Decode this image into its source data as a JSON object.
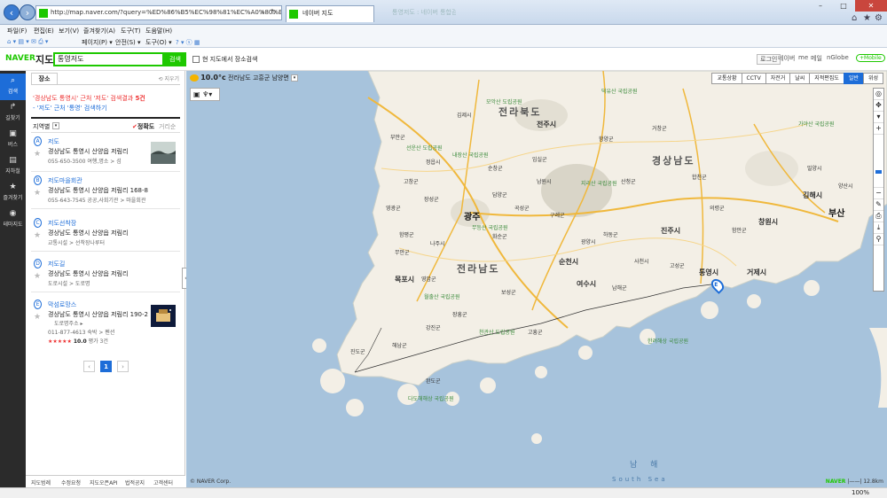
{
  "browser": {
    "url": "http://map.naver.com/?query=%ED%86%B5%EC%98%81%EC%A0%80%EB%8F%84",
    "active_tab": "네이버 지도",
    "inactive_tab": "통영저도 : 네이버 통합검색",
    "menu": [
      "파일(F)",
      "편집(E)",
      "보기(V)",
      "즐겨찾기(A)",
      "도구(T)",
      "도움말(H)"
    ],
    "toolbar": [
      "페이지(P) ▾",
      "안전(S) ▾",
      "도구(O) ▾"
    ],
    "zoom_level": "100%"
  },
  "naver": {
    "logo": "NAVER",
    "service": "지도",
    "search_value": "통영저도",
    "search_button": "검색",
    "checkbox_label": "현 지도에서 장소검색",
    "links": [
      "로그인",
      "네이버",
      "me",
      "메일",
      "nGlobe"
    ],
    "mobile": "+Mobile"
  },
  "sidebar": [
    {
      "label": "검색",
      "icon": "search-icon"
    },
    {
      "label": "길찾기",
      "icon": "directions-icon"
    },
    {
      "label": "버스",
      "icon": "bus-icon"
    },
    {
      "label": "지하철",
      "icon": "subway-icon"
    },
    {
      "label": "즐겨찾기",
      "icon": "star-icon"
    },
    {
      "label": "테마지도",
      "icon": "pin-icon"
    }
  ],
  "panel": {
    "tab": "장소",
    "delete": "지우기",
    "summary_prefix": "'경상남도 통영시' 근처 '저도' 검색결과",
    "summary_count": "5건",
    "sub": "- '저도' 근처 '통영' 검색하기",
    "filter": "지역별",
    "sort_accuracy": "정확도",
    "sort_distance": "거리순",
    "results": [
      {
        "pin": "A",
        "name": "저도",
        "addr": "경상남도 통영시 산양읍 저림리",
        "tel": "055-650-3500  여행,명소 > 섬"
      },
      {
        "pin": "B",
        "name": "저도마을회관",
        "addr": "경상남도 통영시 산양읍 저림리 168-8",
        "tel": "055-643-7545  공공,사회기관 > 마을회관"
      },
      {
        "pin": "C",
        "name": "저도선착장",
        "addr": "경상남도 통영시 산양읍 저림리",
        "tel": "교통시설 > 선착장나루터"
      },
      {
        "pin": "D",
        "name": "저도길",
        "addr": "경상남도 통영시 산양읍 저림리",
        "tel": "도로시설 > 도로명"
      },
      {
        "pin": "E",
        "name": "막섬로망스",
        "addr": "경상남도 통영시 산양읍 저림리 190-2",
        "addr2": "도로명주소 ▸",
        "tel": "011-877-4613  숙박 > 펜션",
        "stars": "★★★★★",
        "score": "10.0",
        "reviews": "평가 3건"
      }
    ],
    "pages": [
      "‹",
      "1",
      "›"
    ]
  },
  "footer": [
    "지도범례",
    "수정요청",
    "지도오픈API",
    "법적공지",
    "고객센터"
  ],
  "map": {
    "weather_temp": "10.0°c",
    "weather_place": "전라남도 고흥군 남양면",
    "layers": [
      "교통상황",
      "CCTV",
      "자전거",
      "날씨",
      "지적편집도",
      "일반",
      "위성"
    ],
    "copyright": "© NAVER Corp.",
    "scale": "12.8km",
    "marker": "E",
    "zoom_controls": [
      "+",
      "−"
    ],
    "labels": {
      "region_jb": "전라북도",
      "region_gn": "경상남도",
      "region_jn": "전라남도",
      "gwangju": "광주",
      "busan": "부산",
      "sea_kr": "남 해",
      "sea_en": "South Sea",
      "parks": [
        "모악산 도립공원",
        "내장산 국립공원",
        "선운산 도립공원",
        "지리산 국립공원",
        "무등산 국립공원",
        "월출산 국립공원",
        "한려해상 국립공원",
        "덕유산 국립공원",
        "가야산 국립공원",
        "다도해해상 국립공원",
        "천관산 도립공원"
      ],
      "cities": [
        "전주시",
        "정읍시",
        "남원시",
        "순천시",
        "여수시",
        "목포시",
        "나주시",
        "진주시",
        "사천시",
        "통영시",
        "거제시",
        "창원시",
        "김해시",
        "함양군",
        "산청군",
        "하동군",
        "광양시",
        "고흥군",
        "보성군",
        "장흥군",
        "강진군",
        "해남군",
        "완도군",
        "진도군",
        "영암군",
        "무안군",
        "함평군",
        "영광군",
        "장성군",
        "담양군",
        "곡성군",
        "구례군",
        "화순군",
        "고창군",
        "부안군",
        "김제시",
        "임실군",
        "순창군",
        "거창군",
        "합천군",
        "의령군",
        "함안군",
        "고성군",
        "남해군",
        "밀양시",
        "양산시"
      ]
    }
  }
}
